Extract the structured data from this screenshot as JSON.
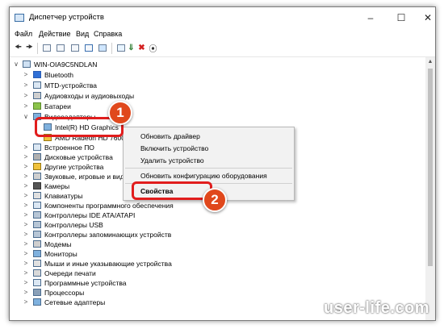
{
  "window": {
    "title": "Диспетчер устройств"
  },
  "menu": {
    "file": "Файл",
    "action": "Действие",
    "view": "Вид",
    "help": "Справка"
  },
  "tree": {
    "root": "WIN-OIA9C5NDLAN",
    "items": [
      "Bluetooth",
      "MTD-устройства",
      "Аудиовходы и аудиовыходы",
      "Батареи",
      "Видеоадаптеры",
      "Intel(R) HD Graphics",
      "AMD Radeon HD 7600M",
      "Встроенное ПО",
      "Дисковые устройства",
      "Другие устройства",
      "Звуковые, игровые и видеоустройства",
      "Камеры",
      "Клавиатуры",
      "Компоненты программного обеспечения",
      "Контроллеры IDE ATA/ATAPI",
      "Контроллеры USB",
      "Контроллеры запоминающих устройств",
      "Модемы",
      "Мониторы",
      "Мыши и иные указывающие устройства",
      "Очереди печати",
      "Программные устройства",
      "Процессоры",
      "Сетевые адаптеры"
    ]
  },
  "context_menu": {
    "update_driver": "Обновить драйвер",
    "enable_device": "Включить устройство",
    "uninstall_device": "Удалить устройство",
    "scan_hardware": "Обновить конфигурацию оборудования",
    "properties": "Свойства"
  },
  "annotations": {
    "step1": "1",
    "step2": "2"
  },
  "watermark": "user-life.com",
  "colors": {
    "highlight": "#e11d1d",
    "badge": "#e0481c"
  }
}
